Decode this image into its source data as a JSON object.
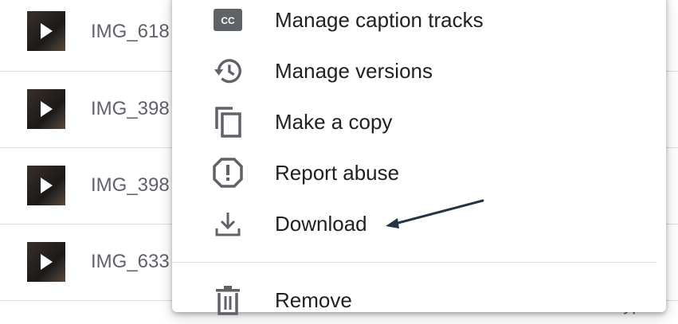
{
  "files": [
    {
      "name": "IMG_618"
    },
    {
      "name": "IMG_398"
    },
    {
      "name": "IMG_398"
    },
    {
      "name": "IMG_633"
    }
  ],
  "background_partial_text": "Type",
  "menu": {
    "items": [
      {
        "label": "Manage caption tracks",
        "icon": "closed-caption-icon"
      },
      {
        "label": "Manage versions",
        "icon": "history-icon"
      },
      {
        "label": "Make a copy",
        "icon": "copy-icon"
      },
      {
        "label": "Report abuse",
        "icon": "report-icon"
      },
      {
        "label": "Download",
        "icon": "download-icon"
      },
      {
        "label": "Remove",
        "icon": "trash-icon"
      }
    ]
  },
  "colors": {
    "icon": "#5f6368",
    "text": "#202124",
    "annotation_arrow": "#263247"
  }
}
